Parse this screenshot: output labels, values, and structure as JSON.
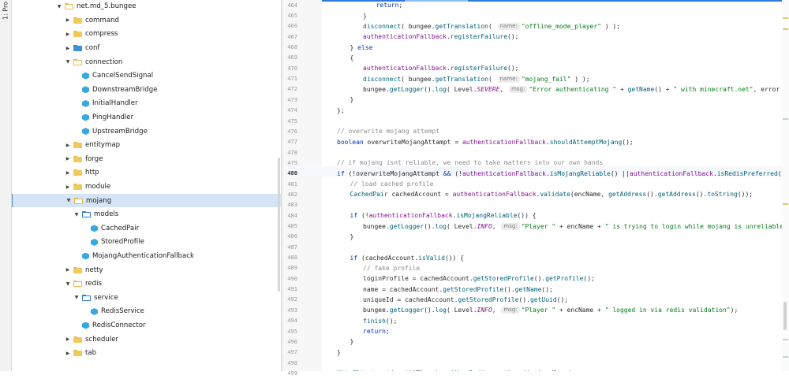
{
  "sidebar_tab": {
    "label": "1: Pro"
  },
  "tree": [
    {
      "label": "net.md_5.bungee",
      "type": "package",
      "depth": 1,
      "open": true
    },
    {
      "label": "command",
      "type": "package",
      "depth": 2,
      "open": false
    },
    {
      "label": "compress",
      "type": "package",
      "depth": 2,
      "open": false
    },
    {
      "label": "conf",
      "type": "package-blue",
      "depth": 2,
      "open": false
    },
    {
      "label": "connection",
      "type": "package",
      "depth": 2,
      "open": true
    },
    {
      "label": "CancelSendSignal",
      "type": "class",
      "depth": 3
    },
    {
      "label": "DownstreamBridge",
      "type": "class",
      "depth": 3
    },
    {
      "label": "InitialHandler",
      "type": "class",
      "depth": 3
    },
    {
      "label": "PingHandler",
      "type": "class",
      "depth": 3
    },
    {
      "label": "UpstreamBridge",
      "type": "class",
      "depth": 3
    },
    {
      "label": "entitymap",
      "type": "package",
      "depth": 2,
      "open": false
    },
    {
      "label": "forge",
      "type": "package",
      "depth": 2,
      "open": false
    },
    {
      "label": "http",
      "type": "package",
      "depth": 2,
      "open": false
    },
    {
      "label": "module",
      "type": "package",
      "depth": 2,
      "open": false
    },
    {
      "label": "mojang",
      "type": "package",
      "depth": 2,
      "open": true,
      "selected": true
    },
    {
      "label": "models",
      "type": "package-blue",
      "depth": 3,
      "open": true
    },
    {
      "label": "CachedPair",
      "type": "class",
      "depth": 4
    },
    {
      "label": "StoredProfile",
      "type": "class",
      "depth": 4
    },
    {
      "label": "MojangAuthenticationFallback",
      "type": "class",
      "depth": 3
    },
    {
      "label": "netty",
      "type": "package",
      "depth": 2,
      "open": false
    },
    {
      "label": "redis",
      "type": "package",
      "depth": 2,
      "open": true
    },
    {
      "label": "service",
      "type": "package-blue",
      "depth": 3,
      "open": true
    },
    {
      "label": "RedisService",
      "type": "class",
      "depth": 4
    },
    {
      "label": "RedisConnector",
      "type": "class",
      "depth": 3
    },
    {
      "label": "scheduler",
      "type": "package",
      "depth": 2,
      "open": false
    },
    {
      "label": "tab",
      "type": "package",
      "depth": 2,
      "open": false
    }
  ],
  "current_line": "480",
  "code": [
    {
      "n": "464",
      "i": 6,
      "t": [
        [
          "kw",
          "return"
        ],
        [
          "",
          "; "
        ]
      ]
    },
    {
      "n": "465",
      "i": 5,
      "t": [
        [
          "",
          "}"
        ]
      ]
    },
    {
      "n": "466",
      "i": 5,
      "t": [
        [
          "mth",
          "disconnect"
        ],
        [
          "",
          "( bungee."
        ],
        [
          "mth",
          "getTranslation"
        ],
        [
          "",
          "( "
        ],
        [
          "hint",
          "name:"
        ],
        [
          "str",
          "\"offline_mode_player\""
        ],
        [
          "",
          " ) );"
        ]
      ]
    },
    {
      "n": "467",
      "i": 5,
      "t": [
        [
          "fld",
          "authenticationFallback"
        ],
        [
          "",
          "."
        ],
        [
          "mth",
          "registerFailure"
        ],
        [
          "",
          "();"
        ]
      ]
    },
    {
      "n": "468",
      "i": 4,
      "t": [
        [
          "",
          "} "
        ],
        [
          "kw",
          "else"
        ]
      ]
    },
    {
      "n": "469",
      "i": 4,
      "t": [
        [
          "",
          "{"
        ]
      ]
    },
    {
      "n": "470",
      "i": 5,
      "t": [
        [
          "fld",
          "authenticationFallback"
        ],
        [
          "",
          "."
        ],
        [
          "mth",
          "registerFailure"
        ],
        [
          "",
          "();"
        ]
      ]
    },
    {
      "n": "471",
      "i": 5,
      "t": [
        [
          "mth",
          "disconnect"
        ],
        [
          "",
          "( bungee."
        ],
        [
          "mth",
          "getTranslation"
        ],
        [
          "",
          "( "
        ],
        [
          "hint",
          "name:"
        ],
        [
          "str",
          "\"mojang_fail\""
        ],
        [
          "",
          " ) );"
        ]
      ]
    },
    {
      "n": "472",
      "i": 5,
      "t": [
        [
          "",
          "bungee."
        ],
        [
          "mth",
          "getLogger"
        ],
        [
          "",
          "()."
        ],
        [
          "mth",
          "log"
        ],
        [
          "",
          "( Level."
        ],
        [
          "cst",
          "SEVERE"
        ],
        [
          "",
          ", "
        ],
        [
          "hint",
          "msg:"
        ],
        [
          "str",
          "\"Error authenticating \""
        ],
        [
          "",
          " + "
        ],
        [
          "mth",
          "getName"
        ],
        [
          "",
          "() + "
        ],
        [
          "str",
          "\" with minecraft.net\""
        ],
        [
          "",
          ", error );"
        ]
      ]
    },
    {
      "n": "473",
      "i": 4,
      "t": [
        [
          "",
          "}"
        ]
      ]
    },
    {
      "n": "474",
      "i": 3,
      "t": [
        [
          "",
          "};"
        ]
      ]
    },
    {
      "n": "475",
      "i": 0,
      "t": []
    },
    {
      "n": "476",
      "i": 3,
      "t": [
        [
          "com",
          "// overwrite mojang attempt"
        ]
      ]
    },
    {
      "n": "477",
      "i": 3,
      "t": [
        [
          "kw",
          "boolean"
        ],
        [
          "",
          " overwriteMojangAttampt = "
        ],
        [
          "fld",
          "authenticationFallback"
        ],
        [
          "",
          "."
        ],
        [
          "mth",
          "shouldAttemptMojang"
        ],
        [
          "",
          "();"
        ]
      ]
    },
    {
      "n": "478",
      "i": 0,
      "t": []
    },
    {
      "n": "479",
      "i": 3,
      "t": [
        [
          "com",
          "// if mojang isnt reliable, we need to take matters into our own hands"
        ]
      ]
    },
    {
      "n": "480",
      "i": 3,
      "t": [
        [
          "kw",
          "if"
        ],
        [
          "",
          " (!overwriteMojangAttampt "
        ],
        [
          "kw",
          "&&"
        ],
        [
          "",
          " (!"
        ],
        [
          "fld",
          "authenticationFallback"
        ],
        [
          "",
          "."
        ],
        [
          "mth",
          "isMojangReliable"
        ],
        [
          "",
          "() "
        ],
        [
          "kw",
          "||"
        ],
        [
          " ",
          ""
        ],
        [
          "fld",
          "authenticationFallback"
        ],
        [
          "",
          "."
        ],
        [
          "mth",
          "isRedisPreferred"
        ],
        [
          "",
          "())) {"
        ]
      ]
    },
    {
      "n": "481",
      "i": 4,
      "t": [
        [
          "com",
          "// load cached profile"
        ]
      ]
    },
    {
      "n": "482",
      "i": 4,
      "t": [
        [
          "mth",
          "CachedPair"
        ],
        [
          "",
          " cachedAccount = "
        ],
        [
          "fld",
          "authenticationFallback"
        ],
        [
          "",
          "."
        ],
        [
          "mth",
          "validate"
        ],
        [
          "",
          "(encName, "
        ],
        [
          "mth",
          "getAddress"
        ],
        [
          "",
          "()."
        ],
        [
          "mth",
          "getAddress"
        ],
        [
          "",
          "()."
        ],
        [
          "mth",
          "toString"
        ],
        [
          "",
          "());"
        ]
      ]
    },
    {
      "n": "483",
      "i": 0,
      "t": []
    },
    {
      "n": "484",
      "i": 4,
      "t": [
        [
          "kw",
          "if"
        ],
        [
          "",
          " (!"
        ],
        [
          "fld",
          "authenticationFallback"
        ],
        [
          "",
          "."
        ],
        [
          "mth",
          "isMojangReliable"
        ],
        [
          "",
          "()) {"
        ]
      ]
    },
    {
      "n": "485",
      "i": 5,
      "t": [
        [
          "",
          "bungee."
        ],
        [
          "mth",
          "getLogger"
        ],
        [
          "",
          "()."
        ],
        [
          "mth",
          "log"
        ],
        [
          "",
          "( Level."
        ],
        [
          "cst",
          "INFO"
        ],
        [
          "",
          ", "
        ],
        [
          "hint",
          "msg:"
        ],
        [
          "str",
          "\"Player \""
        ],
        [
          "",
          " + encName + "
        ],
        [
          "str",
          "\" is trying to login while mojang is unreliable\""
        ],
        [
          "",
          ");"
        ]
      ]
    },
    {
      "n": "486",
      "i": 4,
      "t": [
        [
          "",
          "}"
        ]
      ]
    },
    {
      "n": "487",
      "i": 0,
      "t": []
    },
    {
      "n": "488",
      "i": 4,
      "t": [
        [
          "kw",
          "if"
        ],
        [
          "",
          " (cachedAccount."
        ],
        [
          "mth",
          "isValid"
        ],
        [
          "",
          "()) {"
        ]
      ]
    },
    {
      "n": "489",
      "i": 5,
      "t": [
        [
          "com",
          "// fake profile"
        ]
      ]
    },
    {
      "n": "490",
      "i": 5,
      "t": [
        [
          "",
          "loginProfile = cachedAccount."
        ],
        [
          "mth",
          "getStoredProfile"
        ],
        [
          "",
          "()."
        ],
        [
          "mth",
          "getProfile"
        ],
        [
          "",
          "();"
        ]
      ]
    },
    {
      "n": "491",
      "i": 5,
      "t": [
        [
          "",
          "name = cachedAccount."
        ],
        [
          "mth",
          "getStoredProfile"
        ],
        [
          "",
          "()."
        ],
        [
          "mth",
          "getName"
        ],
        [
          "",
          "();"
        ]
      ]
    },
    {
      "n": "492",
      "i": 5,
      "t": [
        [
          "",
          "uniqueId = cachedAccount."
        ],
        [
          "mth",
          "getStoredProfile"
        ],
        [
          "",
          "()."
        ],
        [
          "mth",
          "getUuid"
        ],
        [
          "",
          "();"
        ]
      ]
    },
    {
      "n": "493",
      "i": 5,
      "t": [
        [
          "",
          "bungee."
        ],
        [
          "mth",
          "getLogger"
        ],
        [
          "",
          "()."
        ],
        [
          "mth",
          "log"
        ],
        [
          "",
          "( Level."
        ],
        [
          "cst",
          "INFO"
        ],
        [
          "",
          ", "
        ],
        [
          "hint",
          "msg:"
        ],
        [
          "str",
          "\"Player \""
        ],
        [
          "",
          " + encName + "
        ],
        [
          "str",
          "\" logged in via redis validation\""
        ],
        [
          "",
          ");"
        ]
      ]
    },
    {
      "n": "494",
      "i": 5,
      "t": [
        [
          "mth",
          "finish"
        ],
        [
          "",
          "();"
        ]
      ]
    },
    {
      "n": "495",
      "i": 5,
      "t": [
        [
          "kw",
          "return"
        ],
        [
          "",
          ";"
        ]
      ]
    },
    {
      "n": "496",
      "i": 4,
      "t": [
        [
          "",
          "}"
        ]
      ]
    },
    {
      "n": "497",
      "i": 3,
      "t": [
        [
          "",
          "}"
        ]
      ]
    },
    {
      "n": "498",
      "i": 0,
      "t": []
    },
    {
      "n": "499",
      "i": 3,
      "t": [
        [
          "mth",
          "HttpClient"
        ],
        [
          "",
          "."
        ],
        [
          "mth",
          "get"
        ],
        [
          "",
          "( authURL, ch."
        ],
        [
          "mth",
          "getHandle"
        ],
        [
          "",
          "()."
        ],
        [
          "mth",
          "eventLoop"
        ],
        [
          "",
          "(), handler );"
        ]
      ]
    }
  ],
  "colors": {
    "accent": "#2a7adf",
    "selection": "#d5e4f6",
    "keyword": "#0033b3",
    "string": "#067d17",
    "method": "#00627a",
    "field": "#871094",
    "comment": "#8c8c8c"
  }
}
